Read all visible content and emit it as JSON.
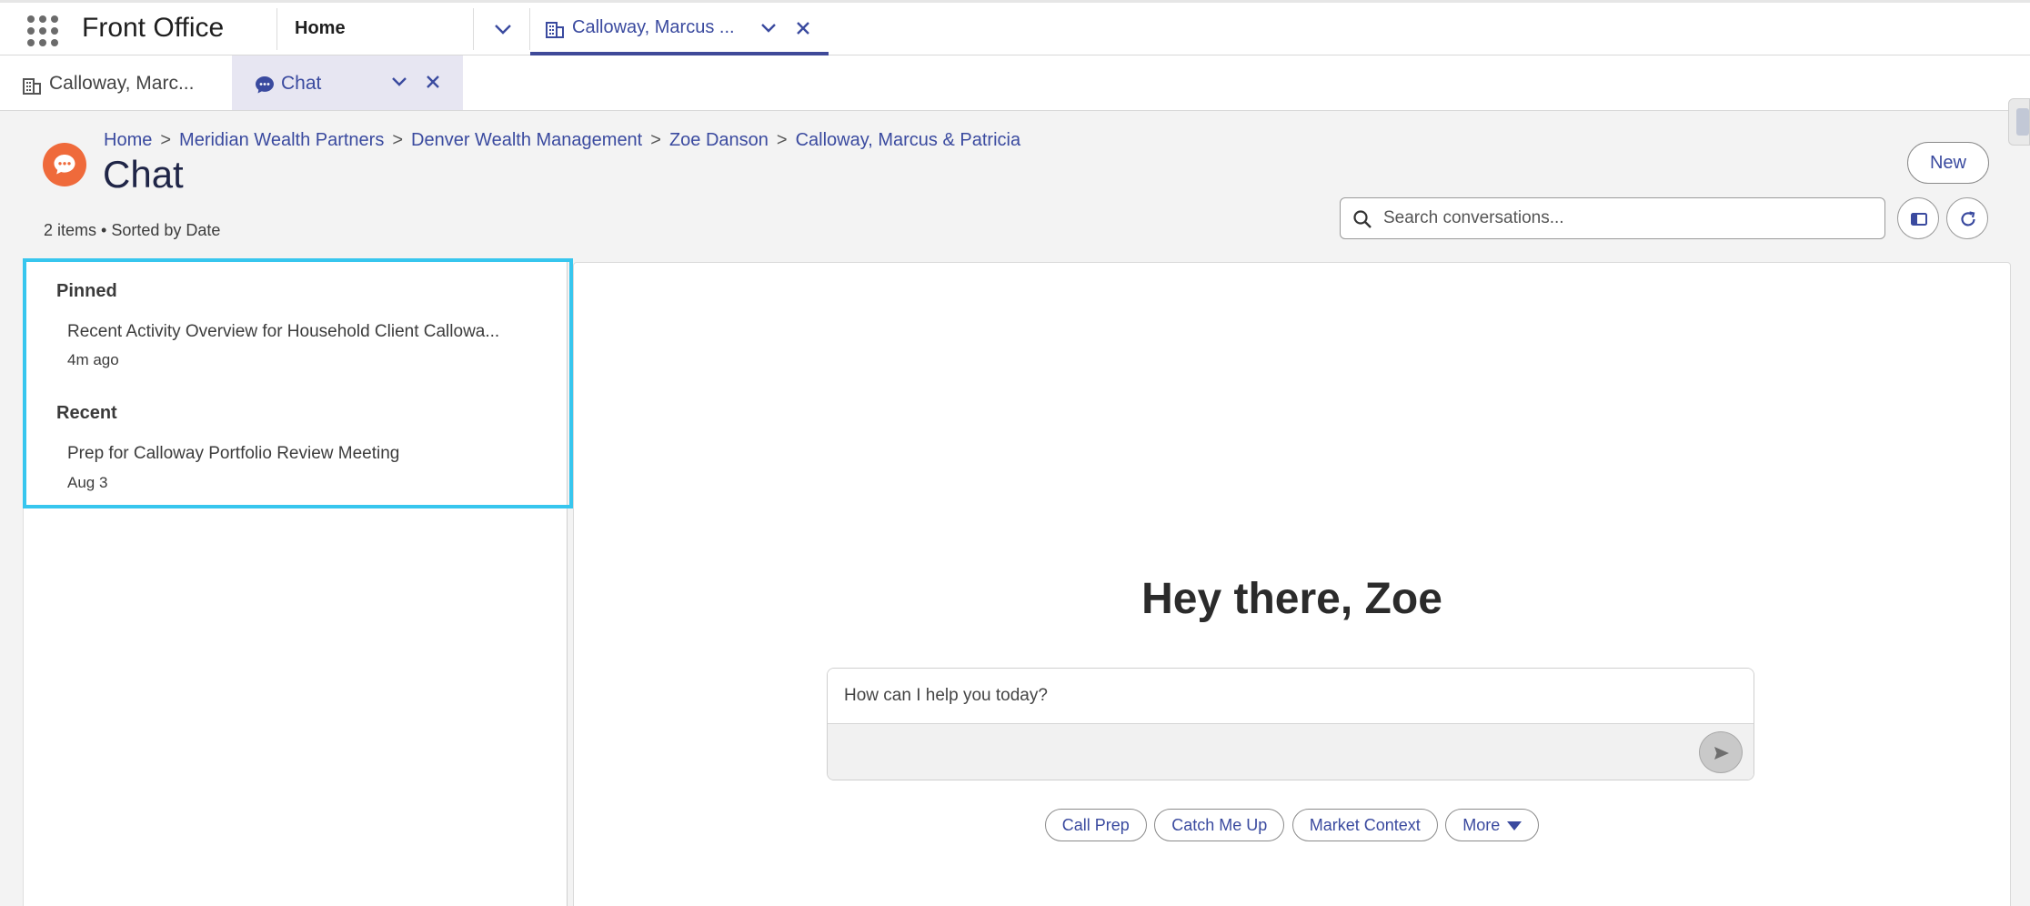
{
  "app": {
    "name": "Front Office"
  },
  "nav": {
    "home_label": "Home",
    "active_tab_label": "Calloway, Marcus ..."
  },
  "subtabs": {
    "record_label": "Calloway, Marc...",
    "chat_label": "Chat"
  },
  "breadcrumb": [
    "Home",
    "Meridian Wealth Partners",
    "Denver Wealth Management",
    "Zoe Danson",
    "Calloway, Marcus & Patricia"
  ],
  "page": {
    "title": "Chat",
    "items_info": "2 items • Sorted by Date",
    "new_button": "New"
  },
  "search": {
    "placeholder": "Search conversations..."
  },
  "conversations": {
    "pinned_label": "Pinned",
    "pinned": [
      {
        "title": "Recent Activity Overview for Household Client Callowa...",
        "time": "4m ago"
      }
    ],
    "recent_label": "Recent",
    "recent": [
      {
        "title": "Prep for Calloway Portfolio Review Meeting",
        "time": "Aug 3"
      }
    ]
  },
  "main": {
    "greeting": "Hey there, Zoe",
    "composer_placeholder": "How can I help you today?",
    "chips": [
      "Call Prep",
      "Catch Me Up",
      "Market Context",
      "More"
    ]
  },
  "colors": {
    "accent": "#3a4a9f",
    "chat_logo": "#ef6a3b",
    "highlight": "#37c6ee"
  }
}
